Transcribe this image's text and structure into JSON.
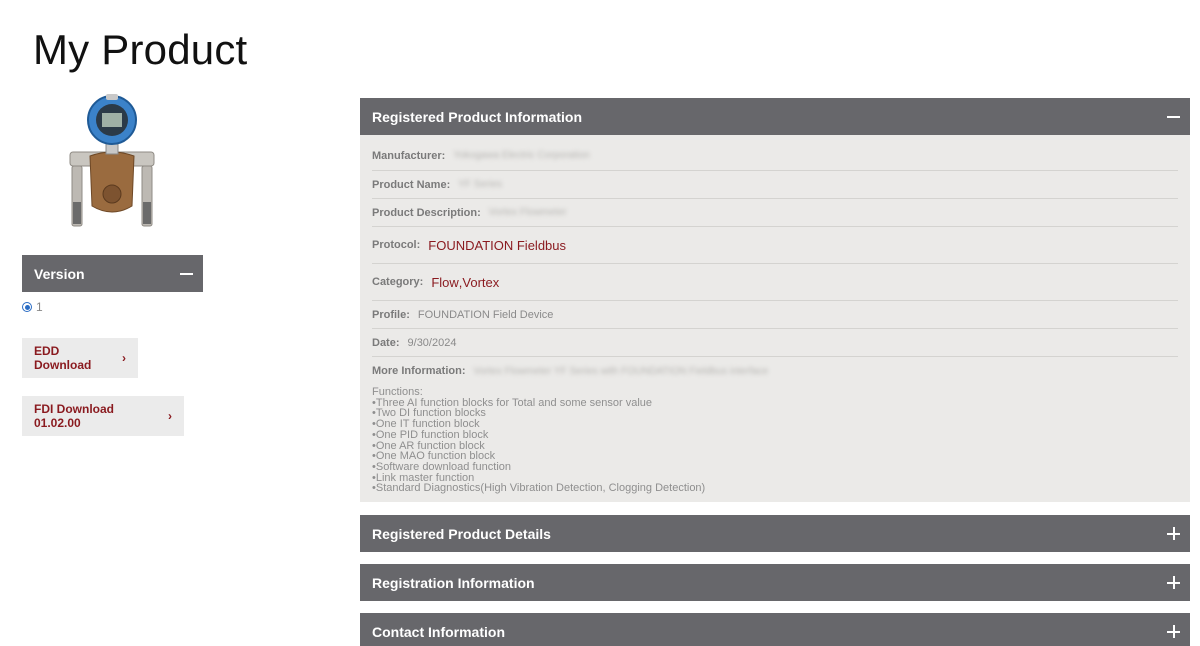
{
  "page": {
    "title": "My Product"
  },
  "version": {
    "header": "Version",
    "options": [
      "1"
    ]
  },
  "downloads": {
    "edd_label": "EDD Download",
    "fdi_label": "FDI Download 01.02.00"
  },
  "registered_info": {
    "header": "Registered Product Information",
    "manufacturer_label": "Manufacturer:",
    "manufacturer_value": "Yokogawa Electric Corporation",
    "product_name_label": "Product Name:",
    "product_name_value": "YF Series",
    "product_description_label": "Product Description:",
    "product_description_value": "Vortex Flowmeter",
    "protocol_label": "Protocol:",
    "protocol_value": "FOUNDATION Fieldbus",
    "category_label": "Category:",
    "category_values": [
      "Flow",
      "Vortex"
    ],
    "category_separator": ",",
    "profile_label": "Profile:",
    "profile_value": "FOUNDATION Field Device",
    "date_label": "Date:",
    "date_value": "9/30/2024",
    "more_info_label": "More Information:",
    "more_info_value": "Vortex Flowmeter YF Series with FOUNDATION Fieldbus interface",
    "functions": [
      "Functions:",
      "•Three AI function blocks for Total and some sensor value",
      "•Two DI function blocks",
      "•One IT function block",
      "•One PID function block",
      "•One AR function block",
      "•One MAO function block",
      "•Software download function",
      "•Link master function",
      "•Standard Diagnostics(High Vibration Detection, Clogging Detection)"
    ]
  },
  "sections": {
    "details": "Registered Product Details",
    "registration": "Registration Information",
    "contact": "Contact Information"
  },
  "icons": {
    "collapse": "minus-icon",
    "expand": "plus-icon",
    "chevron": "chevron-right-icon"
  },
  "colors": {
    "header_bg": "#67676b",
    "link": "#8a1a1f",
    "panel_bg": "#ebeae8"
  }
}
